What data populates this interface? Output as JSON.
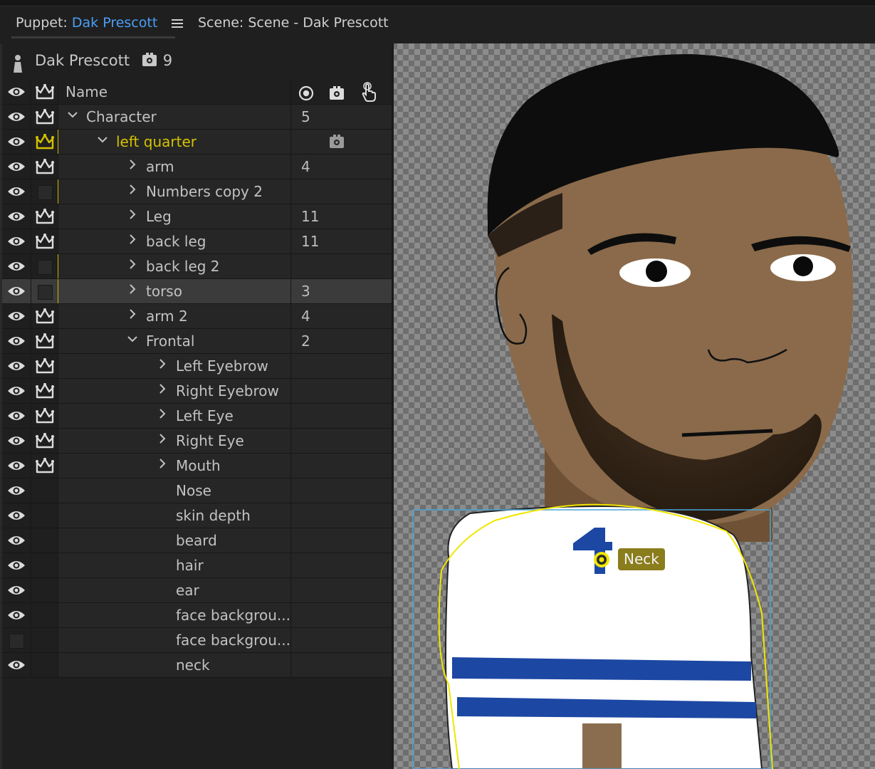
{
  "tabs": {
    "puppet_prefix": "Puppet:",
    "puppet_name": "Dak Prescott",
    "scene_label": "Scene: Scene - Dak Prescott"
  },
  "puppet": {
    "name": "Dak Prescott",
    "behavior_count": "9"
  },
  "columns": {
    "name": "Name"
  },
  "layers": [
    {
      "label": "Character",
      "value": "5"
    },
    {
      "label": "left quarter",
      "value": ""
    },
    {
      "label": "arm",
      "value": "4"
    },
    {
      "label": "Numbers copy 2",
      "value": ""
    },
    {
      "label": "Leg",
      "value": "11"
    },
    {
      "label": "back leg",
      "value": "11"
    },
    {
      "label": "back leg 2",
      "value": ""
    },
    {
      "label": "torso",
      "value": "3"
    },
    {
      "label": "arm 2",
      "value": "4"
    },
    {
      "label": "Frontal",
      "value": "2"
    },
    {
      "label": "Left Eyebrow",
      "value": ""
    },
    {
      "label": "Right Eyebrow",
      "value": ""
    },
    {
      "label": "Left Eye",
      "value": ""
    },
    {
      "label": "Right Eye",
      "value": ""
    },
    {
      "label": "Mouth",
      "value": ""
    },
    {
      "label": "Nose",
      "value": ""
    },
    {
      "label": "skin depth",
      "value": ""
    },
    {
      "label": "beard",
      "value": ""
    },
    {
      "label": "hair",
      "value": ""
    },
    {
      "label": "ear",
      "value": ""
    },
    {
      "label": "face backgrou...",
      "value": ""
    },
    {
      "label": "face backgrou...",
      "value": ""
    },
    {
      "label": "neck",
      "value": ""
    }
  ],
  "canvas": {
    "handle_label": "Neck"
  },
  "colors": {
    "accent": "#4a9ff5",
    "crown_active": "#d4c200",
    "handle": "#8a7d1c",
    "selection_outline": "#4aa3d8",
    "mesh_outline": "#f0e600"
  }
}
